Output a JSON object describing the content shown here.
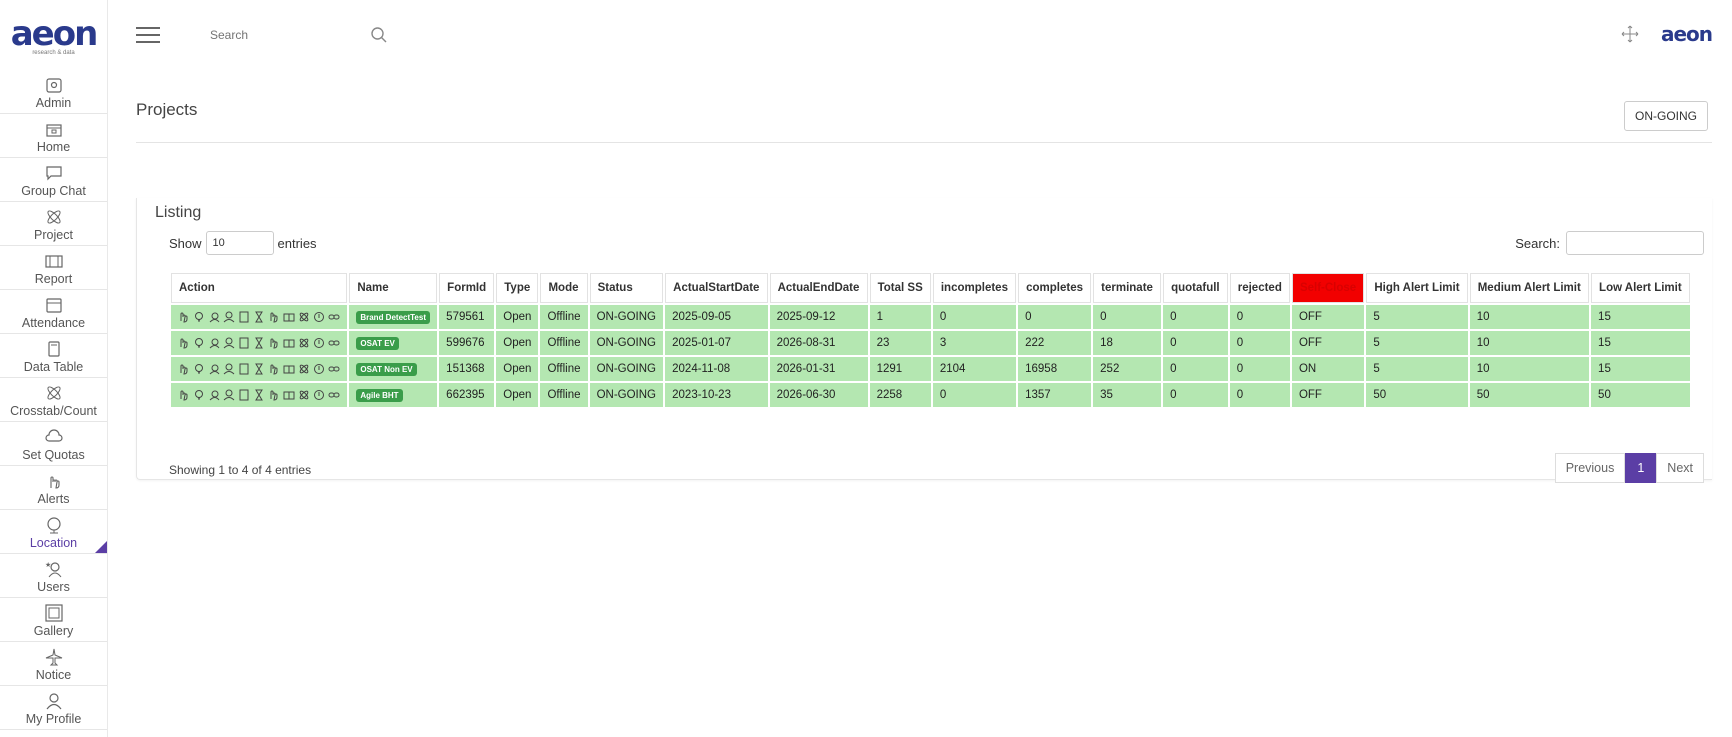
{
  "brand": {
    "logo_text": "aeon",
    "logo_sub": "research & data",
    "mini_logo": "aeon"
  },
  "sidebar": {
    "items": [
      {
        "label": "Admin",
        "icon": "admin-icon"
      },
      {
        "label": "Home",
        "icon": "home-icon"
      },
      {
        "label": "Group Chat",
        "icon": "chat-icon"
      },
      {
        "label": "Project",
        "icon": "project-icon"
      },
      {
        "label": "Report",
        "icon": "report-icon"
      },
      {
        "label": "Attendance",
        "icon": "calendar-icon"
      },
      {
        "label": "Data Table",
        "icon": "document-icon"
      },
      {
        "label": "Crosstab/Count",
        "icon": "atom-icon"
      },
      {
        "label": "Set Quotas",
        "icon": "cloud-icon"
      },
      {
        "label": "Alerts",
        "icon": "hand-icon"
      },
      {
        "label": "Location",
        "icon": "globe-icon",
        "active": true
      },
      {
        "label": "Users",
        "icon": "users-icon"
      },
      {
        "label": "Gallery",
        "icon": "gallery-icon"
      },
      {
        "label": "Notice",
        "icon": "plane-icon"
      },
      {
        "label": "My Profile",
        "icon": "profile-icon"
      }
    ]
  },
  "topbar": {
    "search_placeholder": "Search"
  },
  "page": {
    "title": "Projects",
    "status_button": "ON-GOING"
  },
  "listing": {
    "title": "Listing",
    "show_label": "Show",
    "show_value": "10",
    "entries_label": "entries",
    "search_label": "Search:",
    "columns": [
      "Action",
      "Name",
      "FormId",
      "Type",
      "Mode",
      "Status",
      "ActualStartDate",
      "ActualEndDate",
      "Total SS",
      "incompletes",
      "completes",
      "terminate",
      "quotafull",
      "rejected",
      "Self-Close",
      "High Alert Limit",
      "Medium Alert Limit",
      "Low Alert Limit"
    ],
    "rows": [
      {
        "name": "Brand DetectTest",
        "formid": "579561",
        "type": "Open",
        "mode": "Offline",
        "status": "ON-GOING",
        "start": "2025-09-05",
        "end": "2025-09-12",
        "total": "1",
        "incompletes": "0",
        "completes": "0",
        "terminate": "0",
        "quotafull": "0",
        "rejected": "0",
        "selfclose": "OFF",
        "high": "5",
        "medium": "10",
        "low": "15"
      },
      {
        "name": "OSAT EV",
        "formid": "599676",
        "type": "Open",
        "mode": "Offline",
        "status": "ON-GOING",
        "start": "2025-01-07",
        "end": "2026-08-31",
        "total": "23",
        "incompletes": "3",
        "completes": "222",
        "terminate": "18",
        "quotafull": "0",
        "rejected": "0",
        "selfclose": "OFF",
        "high": "5",
        "medium": "10",
        "low": "15"
      },
      {
        "name": "OSAT Non EV",
        "formid": "151368",
        "type": "Open",
        "mode": "Offline",
        "status": "ON-GOING",
        "start": "2024-11-08",
        "end": "2026-01-31",
        "total": "1291",
        "incompletes": "2104",
        "completes": "16958",
        "terminate": "252",
        "quotafull": "0",
        "rejected": "0",
        "selfclose": "ON",
        "high": "5",
        "medium": "10",
        "low": "15"
      },
      {
        "name": "Agile BHT",
        "formid": "662395",
        "type": "Open",
        "mode": "Offline",
        "status": "ON-GOING",
        "start": "2023-10-23",
        "end": "2026-06-30",
        "total": "2258",
        "incompletes": "0",
        "completes": "1357",
        "terminate": "35",
        "quotafull": "0",
        "rejected": "0",
        "selfclose": "OFF",
        "high": "50",
        "medium": "50",
        "low": "50"
      }
    ],
    "info": "Showing 1 to 4 of 4 entries",
    "pager": {
      "previous": "Previous",
      "current": "1",
      "next": "Next"
    }
  },
  "colors": {
    "accent": "#5b3ea5",
    "row_bg": "#b4e7b1",
    "badge": "#3a9d4a",
    "selfclose_header": "#f20000"
  }
}
